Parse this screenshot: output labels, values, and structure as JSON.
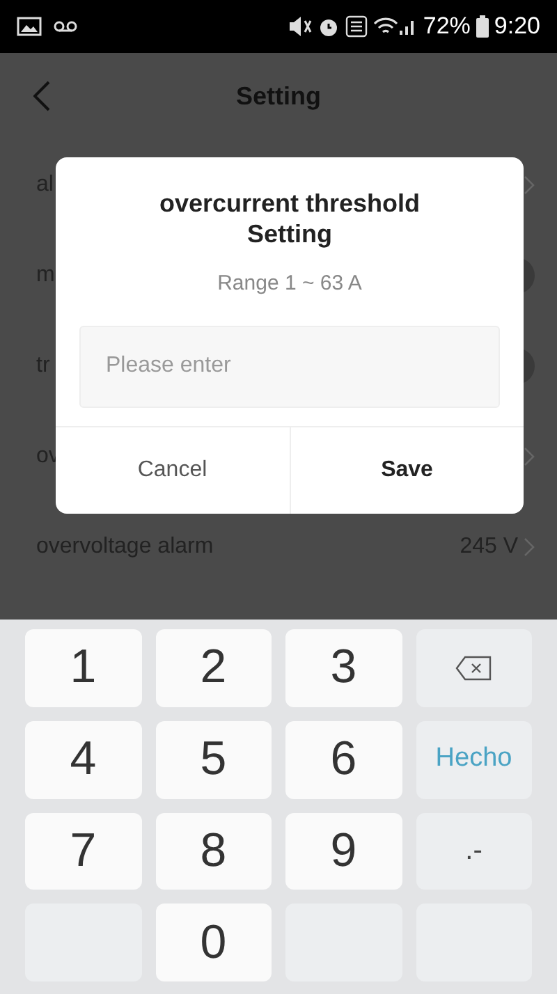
{
  "status_bar": {
    "battery": "72%",
    "time": "9:20"
  },
  "header": {
    "title": "Setting"
  },
  "rows": [
    {
      "label": "al",
      "kind": "arrow"
    },
    {
      "label": "m",
      "kind": "toggle",
      "on": false
    },
    {
      "label": "tr",
      "kind": "toggle",
      "on": false
    },
    {
      "label": "ov",
      "kind": "arrow"
    },
    {
      "label": "overvoltage alarm",
      "kind": "arrow",
      "value": "245 V"
    }
  ],
  "dialog": {
    "title": "overcurrent threshold Setting",
    "subtitle": "Range 1 ~ 63 A",
    "placeholder": "Please enter",
    "buttons": [
      {
        "label": "Cancel",
        "kind": "cancel"
      },
      {
        "label": "Save",
        "kind": "primary"
      }
    ]
  },
  "keyboard": [
    {
      "kind": "digit",
      "label": "1"
    },
    {
      "kind": "digit",
      "label": "2"
    },
    {
      "kind": "digit",
      "label": "3"
    },
    {
      "kind": "backspace"
    },
    {
      "kind": "digit",
      "label": "4"
    },
    {
      "kind": "digit",
      "label": "5"
    },
    {
      "kind": "digit",
      "label": "6"
    },
    {
      "kind": "action",
      "label": "Hecho"
    },
    {
      "kind": "digit",
      "label": "7"
    },
    {
      "kind": "digit",
      "label": "8"
    },
    {
      "kind": "digit",
      "label": "9"
    },
    {
      "kind": "symbol",
      "label": ".-"
    },
    {
      "kind": "blank"
    },
    {
      "kind": "digit",
      "label": "0"
    },
    {
      "kind": "blank"
    },
    {
      "kind": "blank"
    }
  ]
}
